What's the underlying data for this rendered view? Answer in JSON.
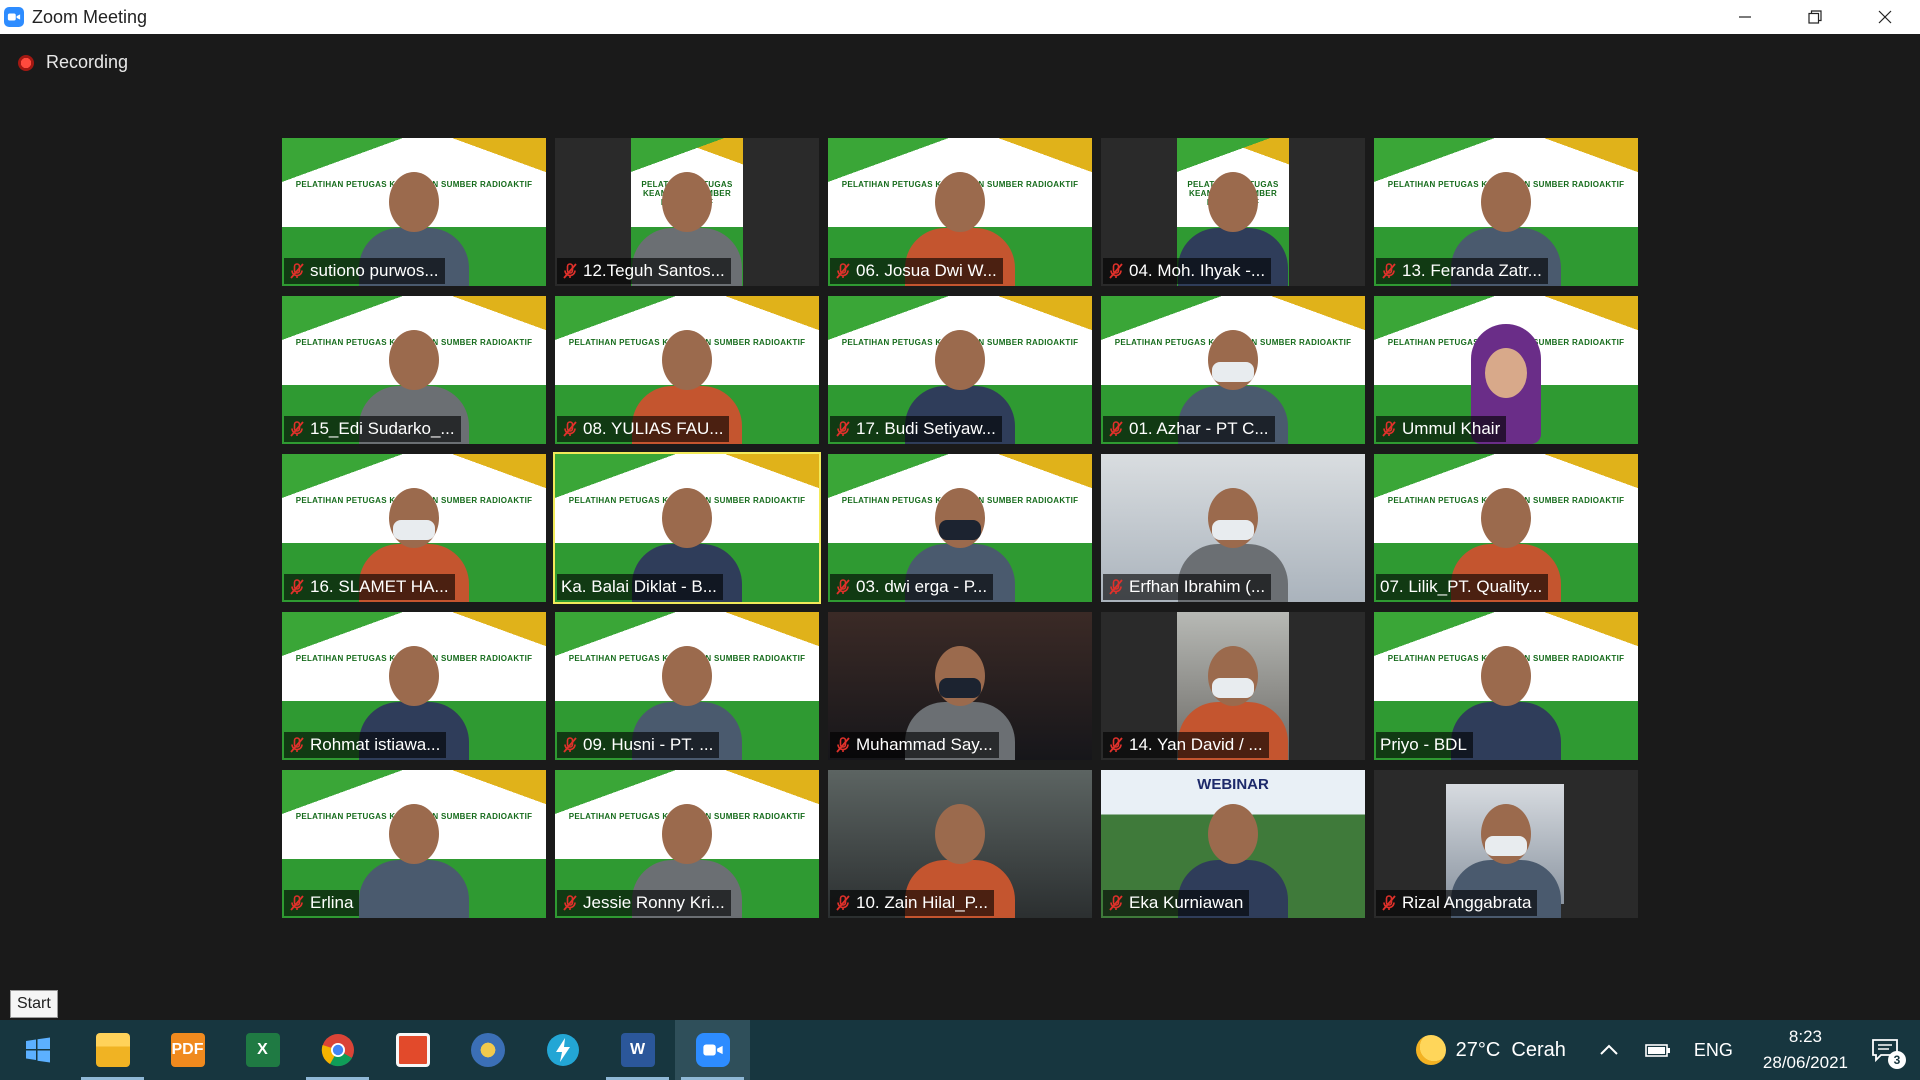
{
  "window": {
    "title": "Zoom Meeting",
    "icon": "zoom-icon",
    "controls": [
      "minimize-icon",
      "restore-icon",
      "close-icon"
    ]
  },
  "meeting": {
    "recording_label": "Recording"
  },
  "banner_text": "PELATIHAN PETUGAS KEAMANAN SUMBER RADIOAKTIF",
  "webinar_text": "WEBINAR",
  "participants": [
    {
      "name": "sutiono purwos...",
      "bg": "banner",
      "muted": true
    },
    {
      "name": "12.Teguh Santos...",
      "bg": "banner-narrow",
      "muted": true
    },
    {
      "name": "06. Josua Dwi W...",
      "bg": "banner",
      "muted": true
    },
    {
      "name": "04. Moh. Ihyak -...",
      "bg": "banner-narrow",
      "muted": true
    },
    {
      "name": "13. Feranda Zatr...",
      "bg": "banner",
      "muted": true
    },
    {
      "name": "15_Edi Sudarko_...",
      "bg": "banner",
      "muted": true
    },
    {
      "name": "08. YULIAS FAU...",
      "bg": "banner",
      "muted": true
    },
    {
      "name": "17. Budi Setiyaw...",
      "bg": "banner",
      "muted": true
    },
    {
      "name": "01. Azhar - PT C...",
      "bg": "banner",
      "muted": true
    },
    {
      "name": "Ummul Khair",
      "bg": "banner",
      "muted": true
    },
    {
      "name": "16. SLAMET HA...",
      "bg": "banner",
      "muted": true
    },
    {
      "name": "Ka. Balai Diklat - B...",
      "bg": "banner",
      "muted": false,
      "active": true
    },
    {
      "name": "03. dwi erga - P...",
      "bg": "banner",
      "muted": true
    },
    {
      "name": "Erfhan Ibrahim (...",
      "bg": "room",
      "muted": true
    },
    {
      "name": "07. Lilik_PT. Quality...",
      "bg": "banner",
      "muted": false
    },
    {
      "name": "Rohmat istiawa...",
      "bg": "banner",
      "muted": true
    },
    {
      "name": "09. Husni - PT. ...",
      "bg": "banner",
      "muted": true
    },
    {
      "name": "Muhammad Say...",
      "bg": "dark",
      "muted": true
    },
    {
      "name": "14. Yan David / ...",
      "bg": "tall",
      "muted": true
    },
    {
      "name": "Priyo - BDL",
      "bg": "banner",
      "muted": false
    },
    {
      "name": "Erlina",
      "bg": "banner",
      "muted": true
    },
    {
      "name": "Jessie Ronny Kri...",
      "bg": "banner",
      "muted": true
    },
    {
      "name": "10. Zain Hilal_P...",
      "bg": "car",
      "muted": true
    },
    {
      "name": "Eka Kurniawan",
      "bg": "trees",
      "muted": true
    },
    {
      "name": "Rizal Anggabrata",
      "bg": "inset",
      "muted": true
    }
  ],
  "start_tooltip": "Start",
  "taskbar": {
    "apps": [
      {
        "name": "start-button",
        "icon": "windows-icon"
      },
      {
        "name": "file-explorer",
        "icon": "folder-icon",
        "open": true
      },
      {
        "name": "pdf-app",
        "icon": "pdf-icon",
        "label": "PDF"
      },
      {
        "name": "excel",
        "icon": "excel-icon",
        "label": "X"
      },
      {
        "name": "chrome",
        "icon": "chrome-icon",
        "open": true
      },
      {
        "name": "presentation-app",
        "icon": "slides-icon"
      },
      {
        "name": "media-app",
        "icon": "media-icon"
      },
      {
        "name": "speed-app",
        "icon": "bolt-icon"
      },
      {
        "name": "word",
        "icon": "word-icon",
        "label": "W",
        "open": true
      },
      {
        "name": "zoom",
        "icon": "zoom-icon",
        "open": true,
        "active": true
      }
    ],
    "weather": "27°C  Cerah",
    "language": "ENG",
    "time": "8:23",
    "date": "28/06/2021",
    "notification_count": "3"
  },
  "colors": {
    "zoom_blue": "#2d8cff",
    "active_speaker": "#f2ea5a",
    "mic_off_red": "#e0312b",
    "taskbar_bg": "#17363f"
  }
}
